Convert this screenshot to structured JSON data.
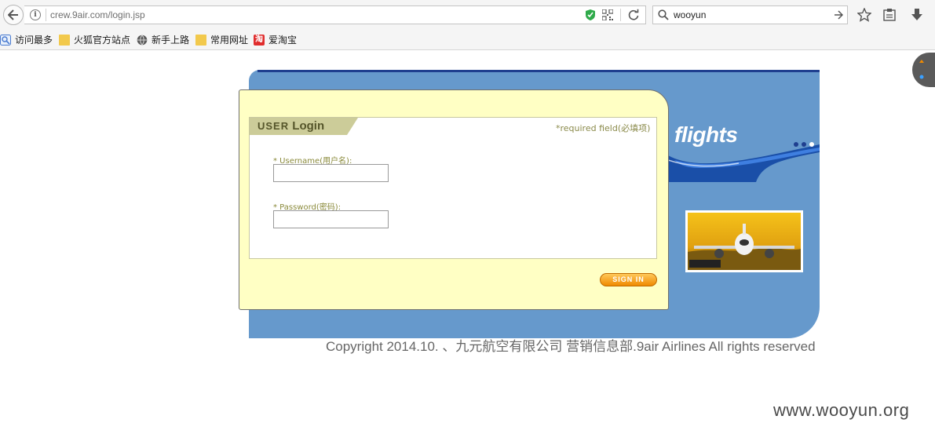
{
  "browser": {
    "url": "crew.9air.com/login.jsp",
    "search_query": "wooyun"
  },
  "bookmarks": [
    {
      "label": "访问最多",
      "icon": "frequent-icon"
    },
    {
      "label": "火狐官方站点",
      "icon": "folder-icon"
    },
    {
      "label": "新手上路",
      "icon": "globe-icon"
    },
    {
      "label": "常用网址",
      "icon": "folder-icon"
    },
    {
      "label": "爱淘宝",
      "icon": "taobao-icon",
      "glyph": "淘"
    }
  ],
  "page": {
    "banner_text": "flights",
    "login": {
      "tab_user": "USER",
      "tab_login": "Login",
      "required_note": "*required field(必填项)",
      "username_label": "* Username(用户名):",
      "username_value": "",
      "password_label": "* Password(密码):",
      "password_value": "",
      "sign_in_label": "SIGN IN"
    },
    "copyright": "Copyright 2014.10. 、九元航空有限公司 营销信息部.9air Airlines All rights reserved"
  },
  "watermark": "www.wooyun.org",
  "colors": {
    "panel_blue": "#6699cc",
    "login_bg": "#ffffc4",
    "tab_bg": "#cccc99",
    "sign_in": "#f08a00"
  }
}
